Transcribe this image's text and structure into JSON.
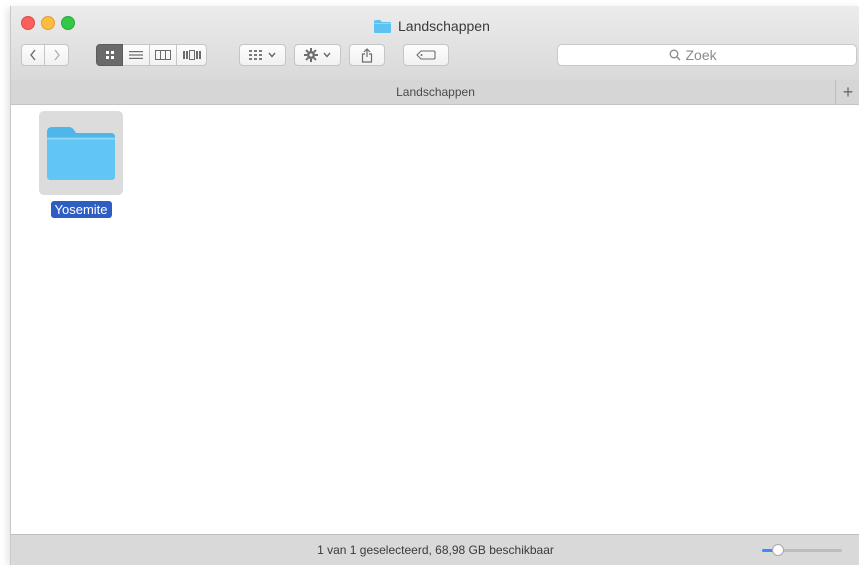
{
  "window": {
    "title": "Landschappen"
  },
  "toolbar": {
    "search_placeholder": "Zoek"
  },
  "pathbar": {
    "label": "Landschappen",
    "add_tab_label": "+"
  },
  "files": [
    {
      "name": "Yosemite",
      "type": "folder",
      "selected": true
    }
  ],
  "statusbar": {
    "text": "1 van 1 geselecteerd, 68,98 GB beschikbaar",
    "icon_size_fraction": 0.2
  },
  "colors": {
    "folder": "#5cc2f2",
    "selection": "#2f5ec3",
    "slider_fill": "#3d8bf6"
  }
}
